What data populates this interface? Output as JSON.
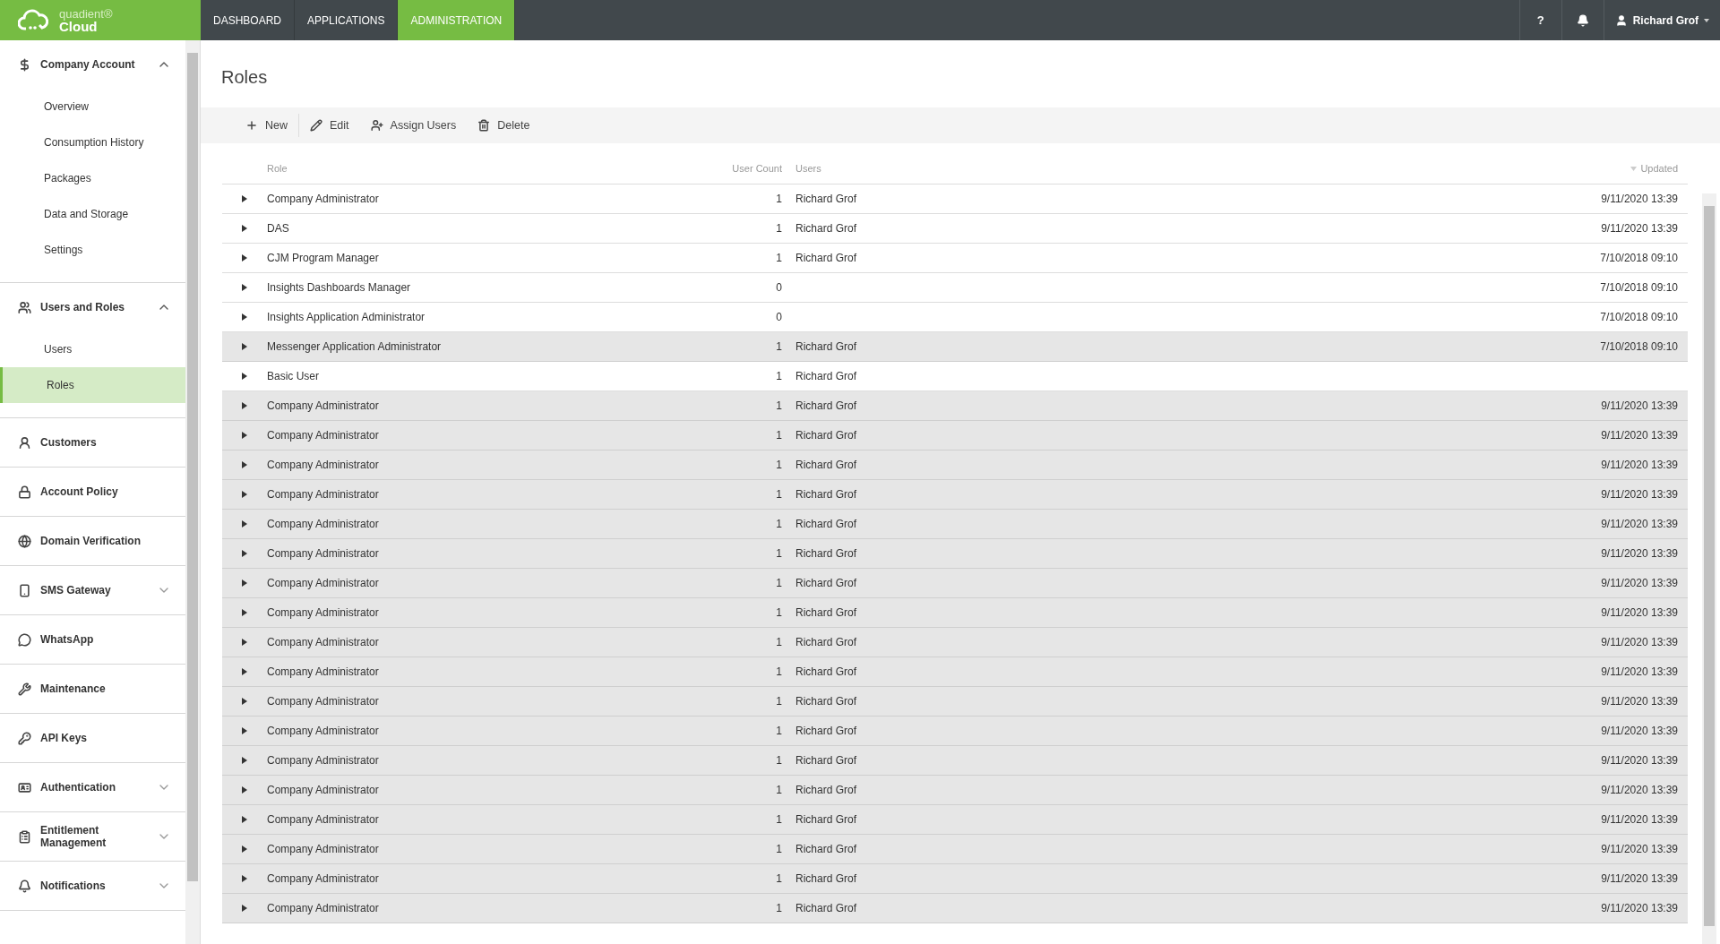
{
  "logo": {
    "brand": "quadient®",
    "product": "Cloud"
  },
  "nav": [
    {
      "label": "DASHBOARD",
      "selected": false
    },
    {
      "label": "APPLICATIONS",
      "selected": false
    },
    {
      "label": "ADMINISTRATION",
      "selected": true
    }
  ],
  "header_right": {
    "help": "?",
    "user": "Richard Grof"
  },
  "sidebar": [
    {
      "label": "Company Account",
      "kind": "group",
      "expanded": true,
      "children": [
        {
          "label": "Overview",
          "selected": false
        },
        {
          "label": "Consumption History",
          "selected": false
        },
        {
          "label": "Packages",
          "selected": false
        },
        {
          "label": "Data and Storage",
          "selected": false
        },
        {
          "label": "Settings",
          "selected": false
        }
      ]
    },
    {
      "label": "Users and Roles",
      "kind": "group",
      "expanded": true,
      "children": [
        {
          "label": "Users",
          "selected": false
        },
        {
          "label": "Roles",
          "selected": true
        }
      ]
    },
    {
      "label": "Customers",
      "kind": "link"
    },
    {
      "label": "Account Policy",
      "kind": "link"
    },
    {
      "label": "Domain Verification",
      "kind": "link"
    },
    {
      "label": "SMS Gateway",
      "kind": "group",
      "expanded": false
    },
    {
      "label": "WhatsApp",
      "kind": "link"
    },
    {
      "label": "Maintenance",
      "kind": "link"
    },
    {
      "label": "API Keys",
      "kind": "link"
    },
    {
      "label": "Authentication",
      "kind": "group",
      "expanded": false
    },
    {
      "label": "Entitlement Management",
      "kind": "group",
      "expanded": false
    },
    {
      "label": "Notifications",
      "kind": "group",
      "expanded": false
    }
  ],
  "page_title": "Roles",
  "toolbar": [
    {
      "label": "New"
    },
    {
      "label": "Edit"
    },
    {
      "label": "Assign Users"
    },
    {
      "label": "Delete"
    }
  ],
  "table": {
    "columns": [
      {
        "label": "Role",
        "sorted": false
      },
      {
        "label": "User Count",
        "sorted": false
      },
      {
        "label": "Users",
        "sorted": false
      },
      {
        "label": "Updated",
        "sorted": true
      }
    ],
    "rows": [
      {
        "role": "Company Administrator",
        "count": "1",
        "users": "Richard Grof",
        "updated": "9/11/2020 13:39",
        "selected": false,
        "expanded": false
      },
      {
        "role": "DAS",
        "count": "1",
        "users": "Richard Grof",
        "updated": "9/11/2020 13:39",
        "selected": false,
        "expanded": false
      },
      {
        "role": "CJM Program Manager",
        "count": "1",
        "users": "Richard Grof",
        "updated": "7/10/2018 09:10",
        "selected": false,
        "expanded": false
      },
      {
        "role": "Insights Dashboards Manager",
        "count": "0",
        "updated": "7/10/2018 09:10",
        "selected": false,
        "expanded": false
      },
      {
        "role": "Insights Application Administrator",
        "count": "0",
        "updated": "7/10/2018 09:10",
        "selected": false,
        "expanded": false
      },
      {
        "role": "Messenger Application Administrator",
        "count": "1",
        "users": "Richard Grof",
        "updated": "7/10/2018 09:10",
        "selected": true,
        "expanded": false
      },
      {
        "role": "Basic User",
        "count": "1",
        "users": "Richard Grof",
        "selected": false,
        "expanded": false
      },
      {
        "role": "Company Administrator",
        "count": "1",
        "users": "Richard Grof",
        "updated": "9/11/2020 13:39",
        "selected": true,
        "expanded": false
      },
      {
        "role": "Company Administrator",
        "count": "1",
        "users": "Richard Grof",
        "updated": "9/11/2020 13:39",
        "selected": true,
        "expanded": false
      },
      {
        "role": "Company Administrator",
        "count": "1",
        "users": "Richard Grof",
        "updated": "9/11/2020 13:39",
        "selected": true,
        "expanded": false
      },
      {
        "role": "Company Administrator",
        "count": "1",
        "users": "Richard Grof",
        "updated": "9/11/2020 13:39",
        "selected": true,
        "expanded": false
      },
      {
        "role": "Company Administrator",
        "count": "1",
        "users": "Richard Grof",
        "updated": "9/11/2020 13:39",
        "selected": true,
        "expanded": false
      },
      {
        "role": "Company Administrator",
        "count": "1",
        "users": "Richard Grof",
        "updated": "9/11/2020 13:39",
        "selected": true,
        "expanded": false
      },
      {
        "role": "Company Administrator",
        "count": "1",
        "users": "Richard Grof",
        "updated": "9/11/2020 13:39",
        "selected": true,
        "expanded": false
      },
      {
        "role": "Company Administrator",
        "count": "1",
        "users": "Richard Grof",
        "updated": "9/11/2020 13:39",
        "selected": true,
        "expanded": false
      },
      {
        "role": "Company Administrator",
        "count": "1",
        "users": "Richard Grof",
        "updated": "9/11/2020 13:39",
        "selected": true,
        "expanded": false
      },
      {
        "role": "Company Administrator",
        "count": "1",
        "users": "Richard Grof",
        "updated": "9/11/2020 13:39",
        "selected": true,
        "expanded": false
      },
      {
        "role": "Company Administrator",
        "count": "1",
        "users": "Richard Grof",
        "updated": "9/11/2020 13:39",
        "selected": true,
        "expanded": false
      },
      {
        "role": "Company Administrator",
        "count": "1",
        "users": "Richard Grof",
        "updated": "9/11/2020 13:39",
        "selected": true,
        "expanded": false
      },
      {
        "role": "Company Administrator",
        "count": "1",
        "users": "Richard Grof",
        "updated": "9/11/2020 13:39",
        "selected": true,
        "expanded": false
      },
      {
        "role": "Company Administrator",
        "count": "1",
        "users": "Richard Grof",
        "updated": "9/11/2020 13:39",
        "selected": true,
        "expanded": false
      },
      {
        "role": "Company Administrator",
        "count": "1",
        "users": "Richard Grof",
        "updated": "9/11/2020 13:39",
        "selected": true,
        "expanded": false
      },
      {
        "role": "Company Administrator",
        "count": "1",
        "users": "Richard Grof",
        "updated": "9/11/2020 13:39",
        "selected": true,
        "expanded": false
      },
      {
        "role": "Company Administrator",
        "count": "1",
        "users": "Richard Grof",
        "updated": "9/11/2020 13:39",
        "selected": true,
        "expanded": false
      },
      {
        "role": "Company Administrator",
        "count": "1",
        "users": "Richard Grof",
        "updated": "9/11/2020 13:39",
        "selected": true,
        "expanded": false
      }
    ]
  }
}
